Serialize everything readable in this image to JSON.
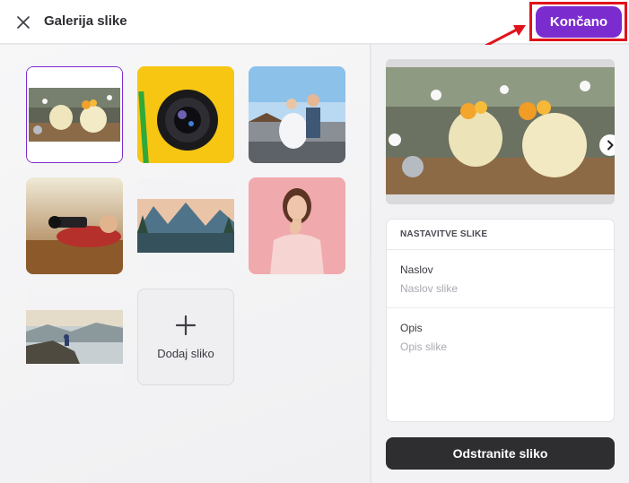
{
  "header": {
    "title": "Galerija slike",
    "done_label": "Končano"
  },
  "gallery": {
    "images": [
      {
        "subject": "desserts-in-jars",
        "selected": true
      },
      {
        "subject": "camera-lens-yellow",
        "selected": false
      },
      {
        "subject": "wedding-couple",
        "selected": false
      },
      {
        "subject": "photographer-autumn",
        "selected": false
      },
      {
        "subject": "mountain-lake",
        "selected": false
      },
      {
        "subject": "woman-portrait-pink",
        "selected": false
      },
      {
        "subject": "hiker-mountain-view",
        "selected": false
      }
    ],
    "add_label": "Dodaj sliko"
  },
  "details": {
    "section_title": "NASTAVITVE SLIKE",
    "title_label": "Naslov",
    "title_placeholder": "Naslov slike",
    "title_value": "",
    "description_label": "Opis",
    "description_placeholder": "Opis slike",
    "description_value": "",
    "remove_label": "Odstranite sliko"
  },
  "colors": {
    "accent": "#7b2ccf",
    "highlight": "#e0131b",
    "dark_button": "#2e2e31"
  },
  "icons": {
    "close": "close-icon",
    "next": "chevron-right-icon",
    "add": "plus-icon"
  }
}
